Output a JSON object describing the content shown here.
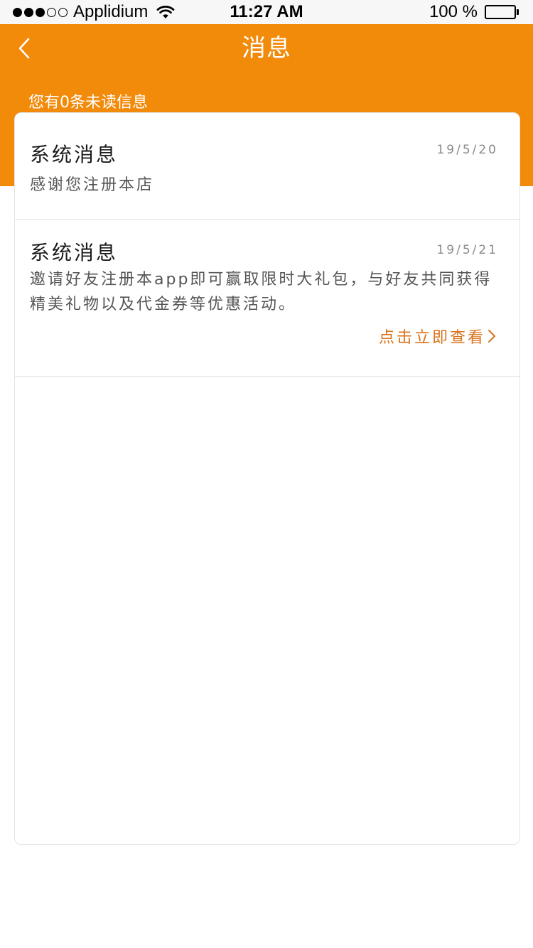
{
  "status_bar": {
    "carrier": "Applidium",
    "time": "11:27 AM",
    "battery": "100 %",
    "signal_strength": "3 of 5",
    "battery_level": 1.0
  },
  "header": {
    "title": "消息",
    "back_icon": "chevron-left-icon",
    "unread_info": "您有0条未读信息"
  },
  "messages": [
    {
      "title": "系统消息",
      "date": "19/5/20",
      "body": "感谢您注册本店"
    },
    {
      "title": "系统消息",
      "date": "19/5/21",
      "body": "邀请好友注册本app即可赢取限时大礼包，与好友共同获得精美礼物以及代金券等优惠活动。",
      "link": "点击立即查看"
    }
  ],
  "colors": {
    "header_bg": "#f28a0a",
    "link": "#d9731a",
    "card_border": "#e4e4e4"
  }
}
